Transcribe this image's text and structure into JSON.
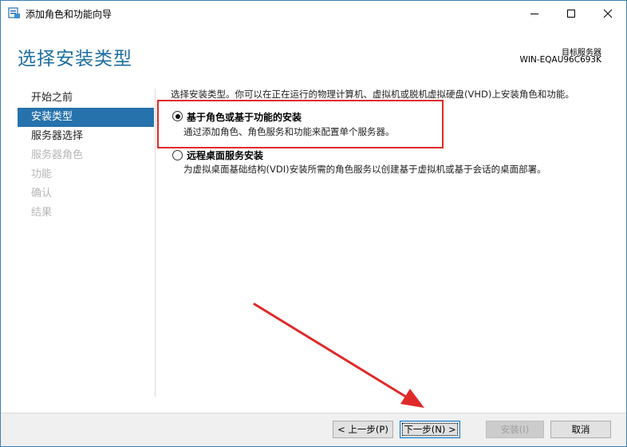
{
  "window": {
    "title": "添加角色和功能向导"
  },
  "header": {
    "page_title": "选择安装类型",
    "dest_label": "目标服务器",
    "dest_server": "WIN-EQAU96C693K"
  },
  "nav": {
    "items": [
      {
        "label": "开始之前",
        "state": "normal"
      },
      {
        "label": "安装类型",
        "state": "active"
      },
      {
        "label": "服务器选择",
        "state": "normal"
      },
      {
        "label": "服务器角色",
        "state": "disabled"
      },
      {
        "label": "功能",
        "state": "disabled"
      },
      {
        "label": "确认",
        "state": "disabled"
      },
      {
        "label": "结果",
        "state": "disabled"
      }
    ]
  },
  "main": {
    "intro": "选择安装类型。你可以在正在运行的物理计算机、虚拟机或脱机虚拟硬盘(VHD)上安装角色和功能。",
    "options": [
      {
        "title": "基于角色或基于功能的安装",
        "description": "通过添加角色、角色服务和功能来配置单个服务器。",
        "selected": true
      },
      {
        "title": "远程桌面服务安装",
        "description": "为虚拟桌面基础结构(VDI)安装所需的角色服务以创建基于虚拟机或基于会话的桌面部署。",
        "selected": false
      }
    ]
  },
  "footer": {
    "prev_label": "< 上一步(P)",
    "next_label": "下一步(N) >",
    "install_label": "安装(I)",
    "cancel_label": "取消"
  },
  "colors": {
    "accent": "#2672ac",
    "title_blue": "#1e6ea0",
    "annotation_red": "#e02a2a"
  }
}
